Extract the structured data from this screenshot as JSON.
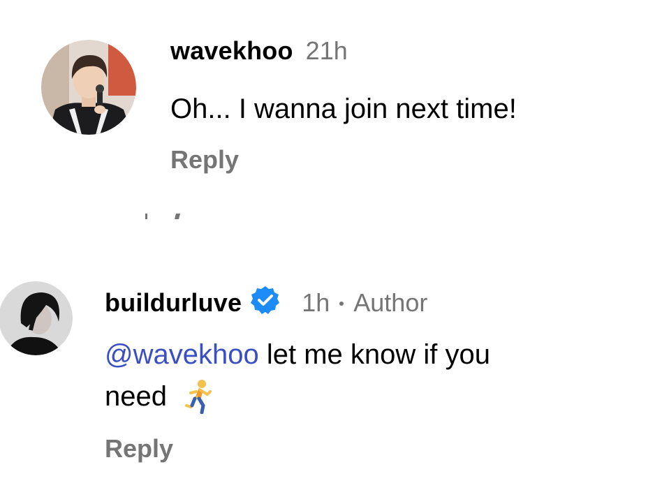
{
  "comments": [
    {
      "username": "wavekhoo",
      "time": "21h",
      "text": "Oh... I wanna join next time!",
      "reply_label": "Reply",
      "avatar_icon": "profile-photo-wavekhoo"
    },
    {
      "username": "buildurluve",
      "verified": true,
      "time": "1h",
      "role": "Author",
      "mention": "@wavekhoo",
      "text_line1": " let me know if you",
      "text_line2": "need",
      "emoji_icon": "person-running-emoji",
      "reply_label": "Reply",
      "avatar_icon": "profile-photo-buildurluve"
    }
  ],
  "colors": {
    "mention": "#3b4fc4",
    "verified_badge": "#1d8cf8",
    "secondary_text": "#757575"
  }
}
